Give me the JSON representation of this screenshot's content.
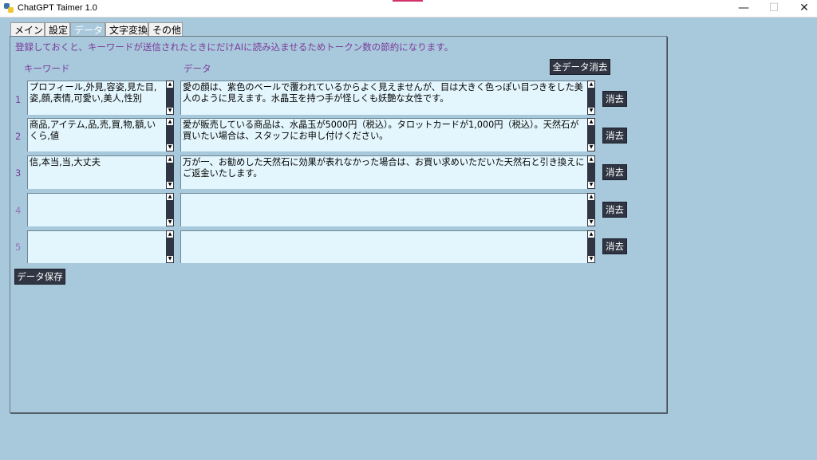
{
  "window": {
    "title": "ChatGPT Taimer 1.0",
    "controls": {
      "minimize": "—",
      "maximize": "☐",
      "close": "✕"
    }
  },
  "tabs": [
    {
      "label": "メイン",
      "active": false
    },
    {
      "label": "設定",
      "active": false
    },
    {
      "label": "データ",
      "active": true
    },
    {
      "label": "文字変換",
      "active": false
    },
    {
      "label": "その他",
      "active": false
    }
  ],
  "info_text": "登録しておくと、キーワードが送信されたときにだけAIに読み込ませるためトークン数の節約になります。",
  "headers": {
    "keyword": "キーワード",
    "data": "データ"
  },
  "buttons": {
    "clear_all": "全データ消去",
    "save": "データ保存",
    "clear": "消去"
  },
  "rows": [
    {
      "num": "1",
      "keyword": "プロフィール,外見,容姿,見た目,姿,顔,表情,可愛い,美人,性別",
      "data": "愛の顔は、紫色のベールで覆われているからよく見えませんが、目は大きく色っぽい目つきをした美人のように見えます。水晶玉を持つ手が怪しくも妖艶な女性です。"
    },
    {
      "num": "2",
      "keyword": "商品,アイテム,品,売,買,物,額,いくら,値",
      "data": "愛が販売している商品は、水晶玉が5000円（税込）。タロットカードが1,000円（税込）。天然石が買いたい場合は、スタッフにお申し付けください。"
    },
    {
      "num": "3",
      "keyword": "信,本当,当,大丈夫",
      "data": "万が一、お勧めした天然石に効果が表れなかった場合は、お買い求めいただいた天然石と引き換えにご返金いたします。"
    },
    {
      "num": "4",
      "keyword": "",
      "data": ""
    },
    {
      "num": "5",
      "keyword": "",
      "data": ""
    }
  ],
  "colors": {
    "background": "#a8c8db",
    "label_text": "#7a3b9c",
    "textbox": "#e3f6fd",
    "button": "#2f3542"
  }
}
